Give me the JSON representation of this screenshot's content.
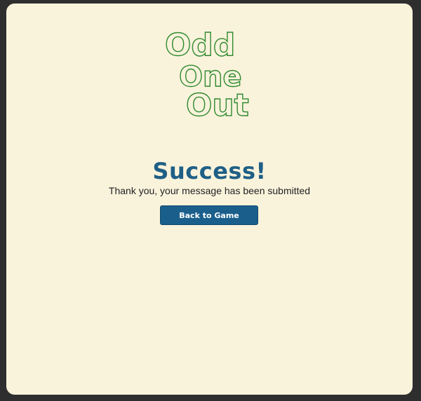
{
  "logo": {
    "line1": "Odd",
    "line2": "One",
    "line3": "Out",
    "color": "#2f8a2f"
  },
  "status": {
    "heading": "Success!",
    "message": "Thank you, your message has been submitted",
    "heading_color": "#1f5f86"
  },
  "actions": {
    "back_label": "Back to Game",
    "button_color": "#1a5f8c"
  }
}
